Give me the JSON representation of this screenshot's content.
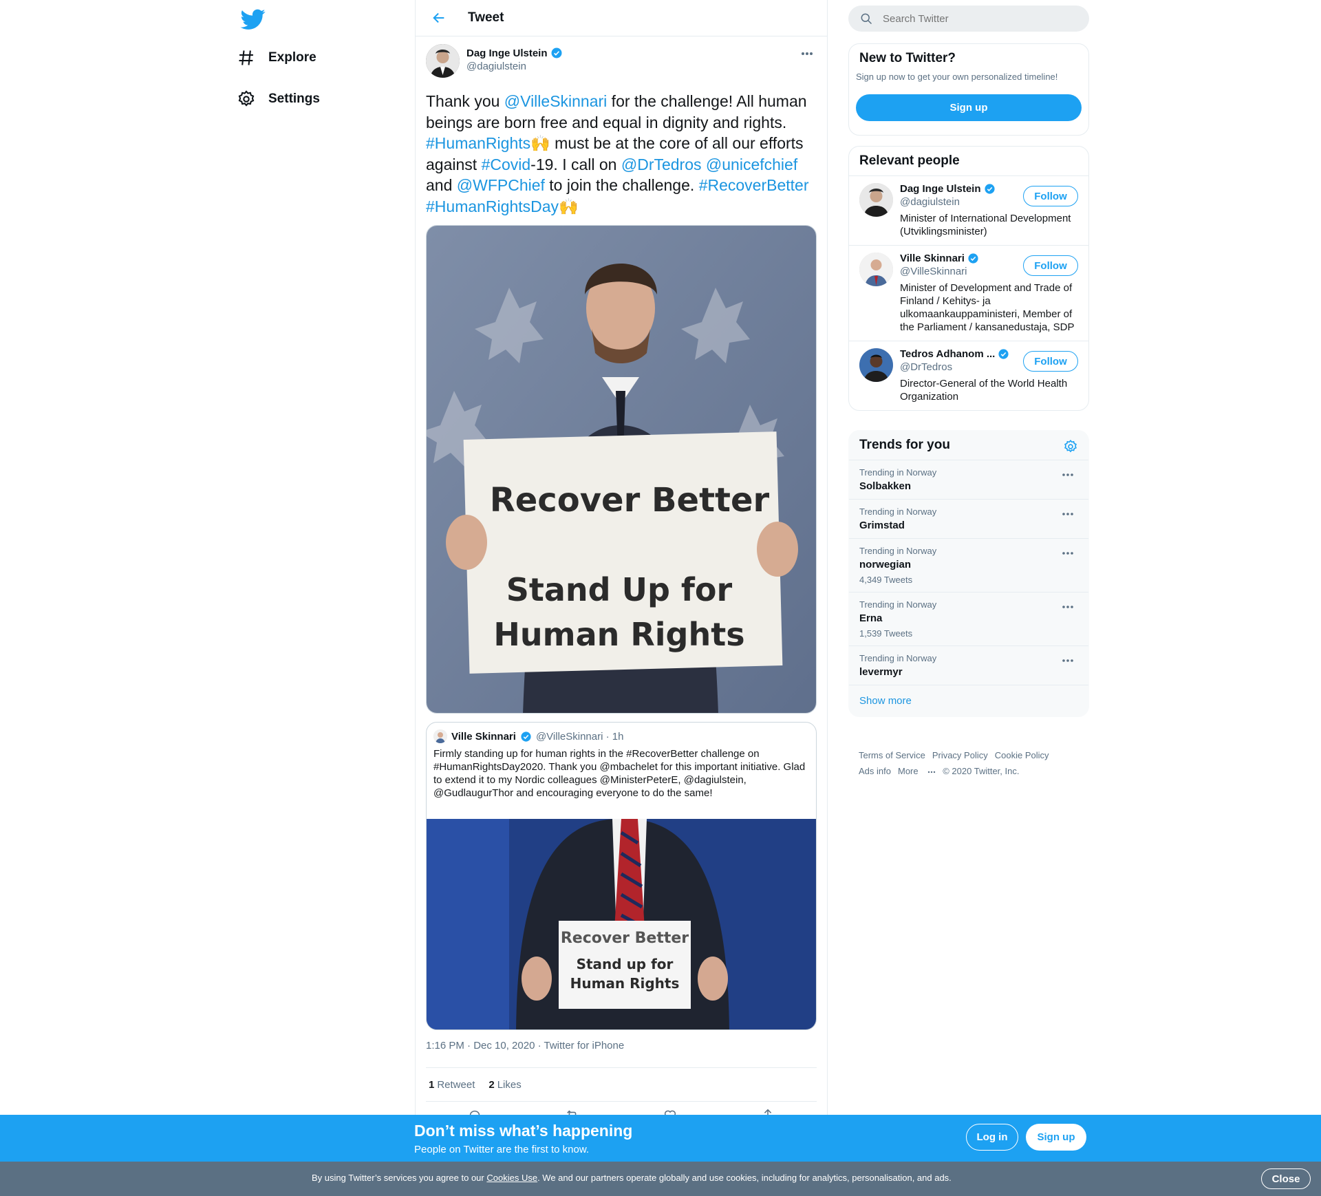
{
  "nav": {
    "explore_label": "Explore",
    "settings_label": "Settings"
  },
  "header": {
    "title": "Tweet"
  },
  "tweet": {
    "author_name": "Dag Inge Ulstein",
    "author_handle": "@dagiulstein",
    "text_parts": [
      {
        "t": "Thank you ",
        "link": false
      },
      {
        "t": "@VilleSkinnari",
        "link": true
      },
      {
        "t": " for the challenge! All human beings are born free and equal in dignity and rights. ",
        "link": false
      },
      {
        "t": "#HumanRights",
        "link": true
      },
      {
        "t": "🙌",
        "link": false
      },
      {
        "t": " must be at the core of all our efforts against ",
        "link": false
      },
      {
        "t": "#Covid",
        "link": true
      },
      {
        "t": "-19. I call on ",
        "link": false
      },
      {
        "t": "@DrTedros",
        "link": true
      },
      {
        "t": " ",
        "link": false
      },
      {
        "t": "@unicefchief",
        "link": true
      },
      {
        "t": " and ",
        "link": false
      },
      {
        "t": "@WFPChief",
        "link": true
      },
      {
        "t": " to join the challenge. ",
        "link": false
      },
      {
        "t": "#RecoverBetter",
        "link": true
      },
      {
        "t": " ",
        "link": false
      },
      {
        "t": "#HumanRightsDay",
        "link": true
      },
      {
        "t": "🙌",
        "link": false
      }
    ],
    "sign_line1": "Recover Better",
    "sign_line2": "Stand Up for",
    "sign_line3": "Human Rights",
    "timestamp": "1:16 PM · Dec 10, 2020 · Twitter for iPhone",
    "retweets_count": "1",
    "retweets_label": "Retweet",
    "likes_count": "2",
    "likes_label": "Likes"
  },
  "quote": {
    "name": "Ville Skinnari",
    "handle": "@VilleSkinnari · 1h",
    "text": "Firmly standing up for human rights in the #RecoverBetter challenge on #HumanRightsDay2020. Thank you @mbachelet for this important initiative. Glad to extend it to my Nordic colleagues @MinisterPeterE, @dagiulstein, @GudlaugurThor and encouraging everyone to do the same!",
    "sign_line1": "Recover Better",
    "sign_line2": "Stand up for",
    "sign_line3": "Human Rights"
  },
  "search": {
    "placeholder": "Search Twitter"
  },
  "new_to_twitter": {
    "title": "New to Twitter?",
    "subtitle": "Sign up now to get your own personalized timeline!",
    "button": "Sign up"
  },
  "relevant": {
    "title": "Relevant people",
    "follow_label": "Follow",
    "people": [
      {
        "name": "Dag Inge Ulstein",
        "handle": "@dagiulstein",
        "bio": "Minister of International Development (Utviklingsminister)"
      },
      {
        "name": "Ville Skinnari",
        "handle": "@VilleSkinnari",
        "bio": "Minister of Development and Trade of Finland / Kehitys- ja ulkomaankauppaministeri, Member of the Parliament / kansanedustaja, SDP"
      },
      {
        "name": "Tedros Adhanom ...",
        "handle": "@DrTedros",
        "bio": "Director-General of the World Health Organization"
      }
    ]
  },
  "trends": {
    "title": "Trends for you",
    "items": [
      {
        "meta": "Trending in Norway",
        "name": "Solbakken",
        "count": ""
      },
      {
        "meta": "Trending in Norway",
        "name": "Grimstad",
        "count": ""
      },
      {
        "meta": "Trending in Norway",
        "name": "norwegian",
        "count": "4,349 Tweets"
      },
      {
        "meta": "Trending in Norway",
        "name": "Erna",
        "count": "1,539 Tweets"
      },
      {
        "meta": "Trending in Norway",
        "name": "levermyr",
        "count": ""
      }
    ],
    "show_more": "Show more"
  },
  "footer": {
    "terms": "Terms of Service",
    "privacy": "Privacy Policy",
    "cookie": "Cookie Policy",
    "ads": "Ads info",
    "more": "More",
    "copyright": "© 2020 Twitter, Inc."
  },
  "bar": {
    "title": "Don’t miss what’s happening",
    "subtitle": "People on Twitter are the first to know.",
    "login": "Log in",
    "signup": "Sign up"
  },
  "cookie": {
    "prefix": "By using Twitter’s services you agree to our ",
    "link": "Cookies Use",
    "suffix": ". We and our partners operate globally and use cookies, including for analytics, personalisation, and ads.",
    "close": "Close"
  },
  "colors": {
    "accent": "#1da1f2",
    "link": "#1b95e0",
    "cookie_bar": "#5b7083"
  }
}
